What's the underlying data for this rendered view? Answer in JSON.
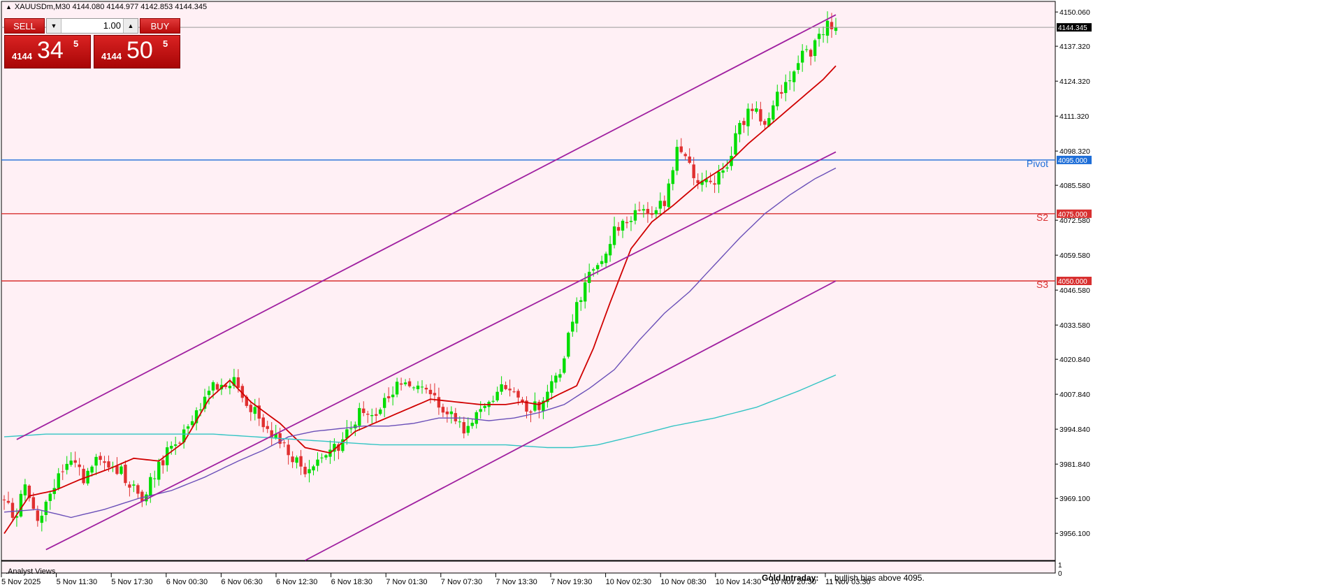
{
  "header": {
    "symbol_line": "XAUUSDm,M30  4144.080 4144.977 4142.853 4144.345"
  },
  "trade_panel": {
    "sell_label": "SELL",
    "buy_label": "BUY",
    "lot_value": "1.00",
    "sell_quote": {
      "prefix": "4144",
      "big": "34",
      "sup": "5"
    },
    "buy_quote": {
      "prefix": "4144",
      "big": "50",
      "sup": "5"
    }
  },
  "footer": {
    "indicator_label": ".Analyst Views",
    "note_title": "Gold Intraday:",
    "note_text": ", bullish bias above 4095.",
    "sub_axis_top": "1",
    "sub_axis_bottom": "0"
  },
  "colors": {
    "background": "#fff0f5",
    "bull": "#00dd00",
    "bear": "#e03030",
    "channel": "#a020a0",
    "ma_fast": "#d00000",
    "ma_mid": "#6a4fb8",
    "ma_slow": "#33c4c4",
    "pivot": "#1e6ed8",
    "support": "#d83030"
  },
  "chart_data": {
    "type": "candlestick",
    "symbol": "XAUUSDm",
    "timeframe": "M30",
    "ohlc_readout": [
      4144.08,
      4144.977,
      4142.853,
      4144.345
    ],
    "current_price": 4144.345,
    "current_price_label": "4144.345",
    "ylim": [
      3946,
      4154
    ],
    "y_ticks": [
      "4150.060",
      "4137.320",
      "4124.320",
      "4111.320",
      "4098.320",
      "4085.580",
      "4072.580",
      "4059.580",
      "4046.580",
      "4033.580",
      "4020.840",
      "4007.840",
      "3994.840",
      "3981.840",
      "3969.100",
      "3956.100"
    ],
    "x_ticks": [
      "5 Nov 2025",
      "5 Nov 11:30",
      "5 Nov 17:30",
      "6 Nov 00:30",
      "6 Nov 06:30",
      "6 Nov 12:30",
      "6 Nov 18:30",
      "7 Nov 01:30",
      "7 Nov 07:30",
      "7 Nov 13:30",
      "7 Nov 19:30",
      "10 Nov 02:30",
      "10 Nov 08:30",
      "10 Nov 14:30",
      "10 Nov 20:30",
      "11 Nov 03:30"
    ],
    "levels": [
      {
        "name": "Pivot",
        "value": 4095.0,
        "label": "4095.000",
        "color": "#1e6ed8"
      },
      {
        "name": "S2",
        "value": 4075.0,
        "label": "4075.000",
        "color": "#d83030"
      },
      {
        "name": "S3",
        "value": 4050.0,
        "label": "4050.000",
        "color": "#d83030"
      }
    ],
    "close_path": [
      [
        0,
        3968
      ],
      [
        3,
        3962
      ],
      [
        5,
        3975
      ],
      [
        8,
        3963
      ],
      [
        11,
        3969
      ],
      [
        14,
        3980
      ],
      [
        17,
        3983
      ],
      [
        19,
        3977
      ],
      [
        22,
        3985
      ],
      [
        25,
        3982
      ],
      [
        28,
        3979
      ],
      [
        31,
        3973
      ],
      [
        33,
        3970
      ],
      [
        36,
        3978
      ],
      [
        39,
        3986
      ],
      [
        42,
        3990
      ],
      [
        45,
        3998
      ],
      [
        48,
        4005
      ],
      [
        50,
        4012
      ],
      [
        52,
        4010
      ],
      [
        55,
        4014
      ],
      [
        58,
        4005
      ],
      [
        61,
        4000
      ],
      [
        64,
        3994
      ],
      [
        67,
        3988
      ],
      [
        69,
        3984
      ],
      [
        72,
        3978
      ],
      [
        75,
        3982
      ],
      [
        78,
        3985
      ],
      [
        81,
        3991
      ],
      [
        84,
        3998
      ],
      [
        86,
        4003
      ],
      [
        89,
        4002
      ],
      [
        92,
        4008
      ],
      [
        95,
        4011
      ],
      [
        98,
        4012
      ],
      [
        101,
        4009
      ],
      [
        104,
        4004
      ],
      [
        107,
        4002
      ],
      [
        110,
        3995
      ],
      [
        113,
        3999
      ],
      [
        116,
        4004
      ],
      [
        119,
        4010
      ],
      [
        122,
        4008
      ],
      [
        125,
        4003
      ],
      [
        128,
        4003
      ],
      [
        130,
        4010
      ],
      [
        133,
        4016
      ],
      [
        135,
        4030
      ],
      [
        137,
        4040
      ],
      [
        139,
        4050
      ],
      [
        141,
        4052
      ],
      [
        144,
        4058
      ],
      [
        146,
        4068
      ],
      [
        149,
        4072
      ],
      [
        152,
        4076
      ],
      [
        155,
        4074
      ],
      [
        158,
        4079
      ],
      [
        160,
        4090
      ],
      [
        161,
        4102
      ],
      [
        163,
        4096
      ],
      [
        165,
        4090
      ],
      [
        167,
        4087
      ],
      [
        169,
        4085
      ],
      [
        172,
        4091
      ],
      [
        174,
        4098
      ],
      [
        176,
        4109
      ],
      [
        179,
        4113
      ],
      [
        182,
        4110
      ],
      [
        185,
        4118
      ],
      [
        187,
        4124
      ],
      [
        189,
        4128
      ],
      [
        191,
        4137
      ],
      [
        193,
        4134
      ],
      [
        195,
        4141
      ],
      [
        197,
        4145
      ],
      [
        199,
        4144.3
      ]
    ],
    "candle_count": 200,
    "moving_averages": [
      {
        "points": [
          [
            0,
            3956
          ],
          [
            6,
            3970
          ],
          [
            12,
            3972
          ],
          [
            18,
            3976
          ],
          [
            25,
            3980
          ],
          [
            31,
            3984
          ],
          [
            37,
            3983
          ],
          [
            43,
            3990
          ],
          [
            49,
            4006
          ],
          [
            54,
            4013
          ],
          [
            59,
            4005
          ],
          [
            66,
            3997
          ],
          [
            72,
            3988
          ],
          [
            78,
            3986
          ],
          [
            84,
            3994
          ],
          [
            90,
            3998
          ],
          [
            96,
            4002
          ],
          [
            102,
            4006
          ],
          [
            108,
            4005
          ],
          [
            114,
            4004
          ],
          [
            120,
            4004
          ],
          [
            124,
            4005
          ],
          [
            128,
            4004
          ],
          [
            133,
            4008
          ],
          [
            137,
            4011
          ],
          [
            141,
            4025
          ],
          [
            145,
            4042
          ],
          [
            150,
            4062
          ],
          [
            155,
            4072
          ],
          [
            160,
            4078
          ],
          [
            166,
            4086
          ],
          [
            172,
            4092
          ],
          [
            178,
            4101
          ],
          [
            184,
            4109
          ],
          [
            190,
            4117
          ],
          [
            196,
            4125
          ],
          [
            199,
            4130
          ]
        ]
      },
      {
        "points": [
          [
            0,
            3964
          ],
          [
            8,
            3965
          ],
          [
            16,
            3962
          ],
          [
            24,
            3965
          ],
          [
            32,
            3969
          ],
          [
            40,
            3972
          ],
          [
            48,
            3977
          ],
          [
            56,
            3983
          ],
          [
            62,
            3987
          ],
          [
            68,
            3992
          ],
          [
            74,
            3994
          ],
          [
            80,
            3995
          ],
          [
            86,
            3996
          ],
          [
            92,
            3996
          ],
          [
            98,
            3997
          ],
          [
            104,
            3999
          ],
          [
            110,
            3999
          ],
          [
            116,
            3998
          ],
          [
            122,
            3999
          ],
          [
            128,
            4001
          ],
          [
            134,
            4004
          ],
          [
            140,
            4010
          ],
          [
            146,
            4017
          ],
          [
            152,
            4028
          ],
          [
            158,
            4038
          ],
          [
            164,
            4046
          ],
          [
            170,
            4056
          ],
          [
            176,
            4066
          ],
          [
            182,
            4075
          ],
          [
            188,
            4082
          ],
          [
            194,
            4088
          ],
          [
            199,
            4092
          ]
        ]
      },
      {
        "points": [
          [
            0,
            3992
          ],
          [
            10,
            3993
          ],
          [
            20,
            3993
          ],
          [
            30,
            3993
          ],
          [
            40,
            3993
          ],
          [
            50,
            3993
          ],
          [
            60,
            3992
          ],
          [
            70,
            3991
          ],
          [
            80,
            3990
          ],
          [
            90,
            3989
          ],
          [
            100,
            3989
          ],
          [
            110,
            3989
          ],
          [
            120,
            3989
          ],
          [
            130,
            3988
          ],
          [
            136,
            3988
          ],
          [
            142,
            3989
          ],
          [
            150,
            3992
          ],
          [
            160,
            3996
          ],
          [
            170,
            3999
          ],
          [
            180,
            4003
          ],
          [
            190,
            4009
          ],
          [
            199,
            4015
          ]
        ]
      }
    ],
    "channel_lines": [
      {
        "from": [
          3,
          3991
        ],
        "to": [
          199,
          4149
        ]
      },
      {
        "from": [
          10,
          3950
        ],
        "to": [
          199,
          4098
        ]
      },
      {
        "from": [
          72,
          3946
        ],
        "to": [
          199,
          4050
        ]
      }
    ]
  }
}
